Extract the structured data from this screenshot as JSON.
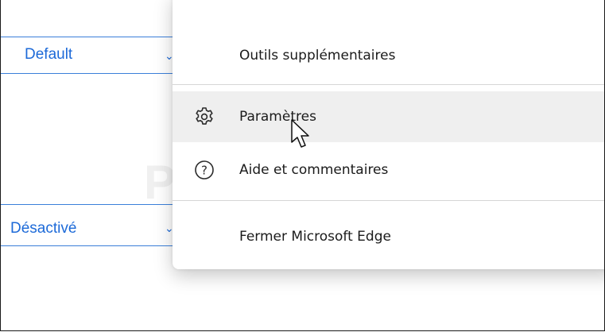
{
  "background": {
    "select_default": "Default",
    "select_disabled": "Désactivé",
    "accent_color": "#1d6ad8"
  },
  "watermark": "PC ASTUCES",
  "menu": {
    "items": [
      {
        "label": "Outils supplémentaires",
        "icon": "none"
      },
      {
        "label": "Paramètres",
        "icon": "gear-icon",
        "hovered": true
      },
      {
        "label": "Aide et commentaires",
        "icon": "help-circle-icon"
      },
      {
        "label": "Fermer Microsoft Edge",
        "icon": "none"
      }
    ]
  }
}
